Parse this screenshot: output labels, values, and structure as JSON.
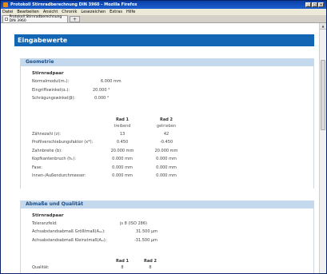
{
  "window": {
    "title": "Protokoll Stirnradberechnung DIN 3960 - Mozilla Firefox",
    "controls": [
      "_",
      "□",
      "×"
    ]
  },
  "menu": [
    "Datei",
    "Bearbeiten",
    "Ansicht",
    "Chronik",
    "Lesezeichen",
    "Extras",
    "Hilfe"
  ],
  "tab": {
    "label": "Protokoll Stirnradberechnung DIN 3960",
    "new_tab": "+"
  },
  "page": {
    "header": "Eingabewerte"
  },
  "geometrie": {
    "title": "Geometrie",
    "subhead": "Stirnradpaar",
    "rows": [
      {
        "label": "Normalmodul(mₙ):",
        "value": "6.000 mm"
      },
      {
        "label": "Eingriffswinkel(αₙ):",
        "value": "20.000 °"
      },
      {
        "label": "Schrägungswinkel(β):",
        "value": "0.000 °"
      }
    ],
    "col1": "Rad 1",
    "col2": "Rad 2",
    "col1_sub": "treibend",
    "col2_sub": "getrieben",
    "table": [
      {
        "label": "Zähnezahl (z):",
        "v1": "13",
        "v2": "42"
      },
      {
        "label": "Profilverschiebungsfaktor (x*):",
        "v1": "0.450",
        "v2": "-0.450"
      },
      {
        "label": "Zahnbreite (b):",
        "v1": "20.000 mm",
        "v2": "20.000 mm"
      },
      {
        "label": "Kopfkantenbruch (hₖ):",
        "v1": "0.000 mm",
        "v2": "0.000 mm"
      },
      {
        "label": "Fase:",
        "v1": "0.000 mm",
        "v2": "0.000 mm"
      },
      {
        "label": "Innen-/Außendurchmesser:",
        "v1": "0.000 mm",
        "v2": "0.000 mm"
      }
    ]
  },
  "abmasse": {
    "title": "Abmaße und Qualität",
    "subhead": "Stirnradpaar",
    "rows": [
      {
        "label": "Toleranzfeld:",
        "value": "js 8 (ISO 286)"
      },
      {
        "label": "Achsabstandsabmaß Größtmaß(Aₐₑ):",
        "value": "31.500 µm"
      },
      {
        "label": "Achsabstandsabmaß Kleinstmaß(Aₐᵢ):",
        "value": "-31.500 µm"
      }
    ],
    "col1": "Rad 1",
    "col2": "Rad 2",
    "table": [
      {
        "label": "Qualität:",
        "v1": "8",
        "v2": "8"
      }
    ]
  }
}
